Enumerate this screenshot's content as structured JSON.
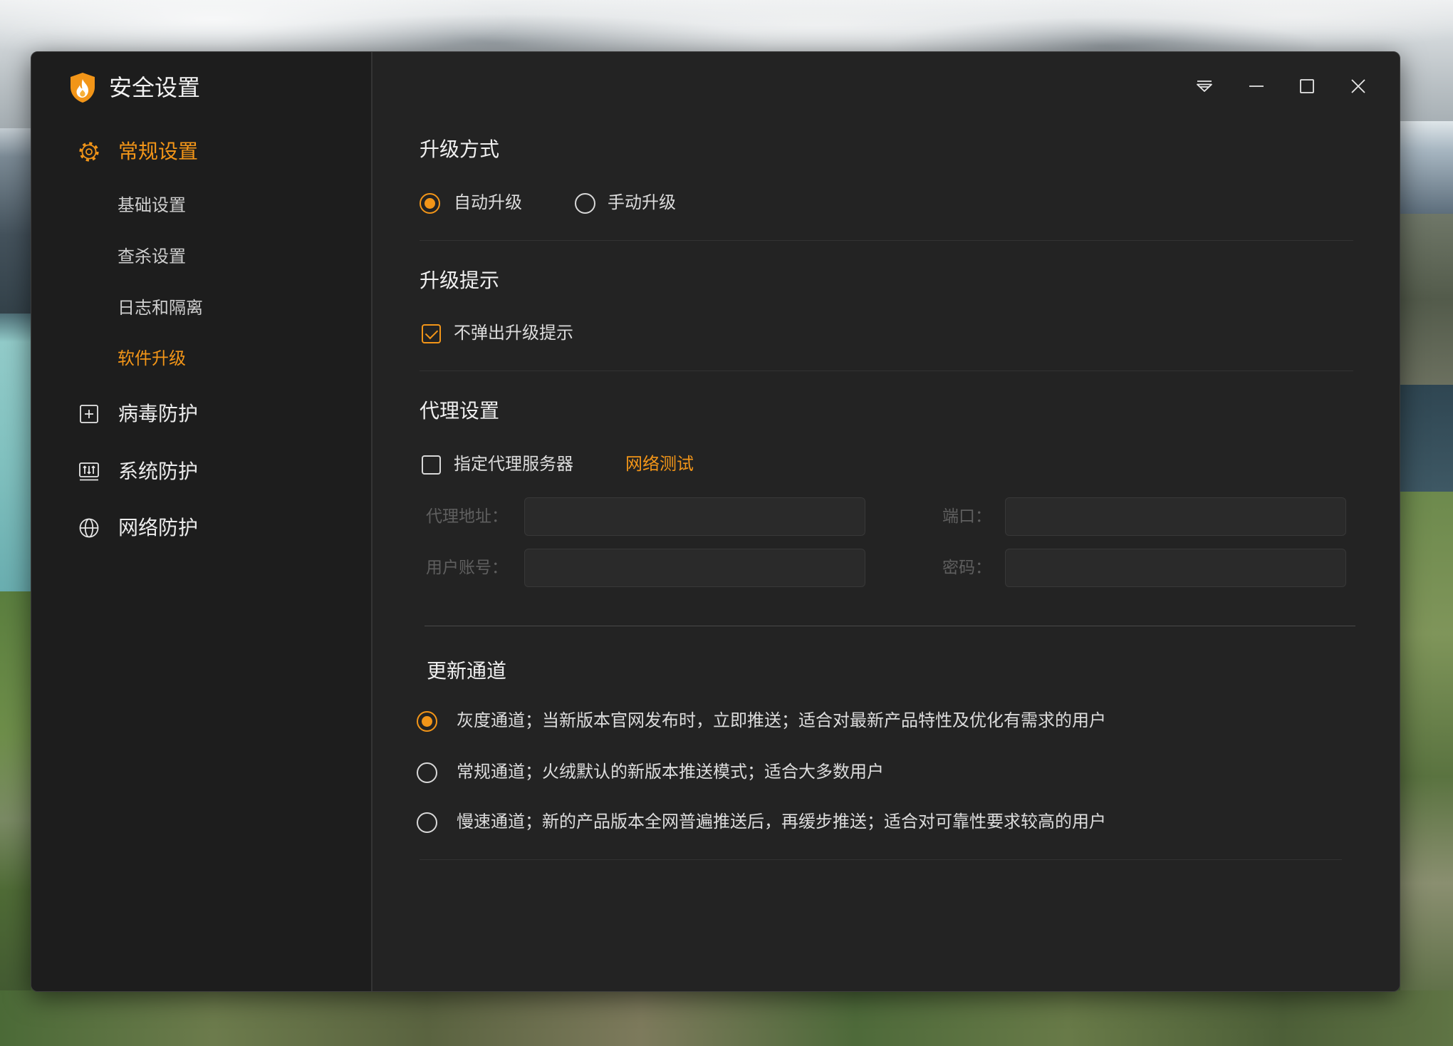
{
  "window": {
    "title": "安全设置",
    "logo_icon": "shield-flame-icon",
    "controls": [
      {
        "name": "menu",
        "icon": "dropdown-menu-icon"
      },
      {
        "name": "minimize",
        "icon": "minimize-icon"
      },
      {
        "name": "maximize",
        "icon": "maximize-icon"
      },
      {
        "name": "close",
        "icon": "close-icon"
      }
    ]
  },
  "nav": [
    {
      "label": "常规设置",
      "icon": "gear-icon",
      "active": true,
      "children": [
        {
          "label": "基础设置",
          "active": false
        },
        {
          "label": "查杀设置",
          "active": false
        },
        {
          "label": "日志和隔离",
          "active": false
        },
        {
          "label": "软件升级",
          "active": true
        }
      ]
    },
    {
      "label": "病毒防护",
      "icon": "plus-square-icon",
      "active": false
    },
    {
      "label": "系统防护",
      "icon": "monitor-sliders-icon",
      "active": false
    },
    {
      "label": "网络防护",
      "icon": "globe-icon",
      "active": false
    }
  ],
  "upgrade_mode": {
    "heading": "升级方式",
    "options": [
      {
        "label": "自动升级",
        "selected": true
      },
      {
        "label": "手动升级",
        "selected": false
      }
    ]
  },
  "upgrade_prompt": {
    "heading": "升级提示",
    "option": {
      "label": "不弹出升级提示",
      "checked": true
    }
  },
  "proxy": {
    "heading": "代理设置",
    "option": {
      "label": "指定代理服务器",
      "checked": false
    },
    "test_link": "网络测试",
    "fields": [
      {
        "label": "代理地址：",
        "value": ""
      },
      {
        "label": "端口：",
        "value": ""
      },
      {
        "label": "用户账号：",
        "value": ""
      },
      {
        "label": "密码：",
        "value": ""
      }
    ]
  },
  "update_channel": {
    "heading": "更新通道",
    "options": [
      {
        "label": "灰度通道；当新版本官网发布时，立即推送；适合对最新产品特性及优化有需求的用户",
        "selected": true
      },
      {
        "label": "常规通道；火绒默认的新版本推送模式；适合大多数用户",
        "selected": false
      },
      {
        "label": "慢速通道；新的产品版本全网普遍推送后，再缓步推送；适合对可靠性要求较高的用户",
        "selected": false
      }
    ]
  },
  "colors": {
    "accent": "#f29518",
    "window_bg": "#232323",
    "sidebar_bg": "#1d1d1d",
    "text": "#e6e6e6",
    "muted_label": "#5f5f5f",
    "divider": "#323232",
    "input_bg": "#2a2a2a"
  }
}
